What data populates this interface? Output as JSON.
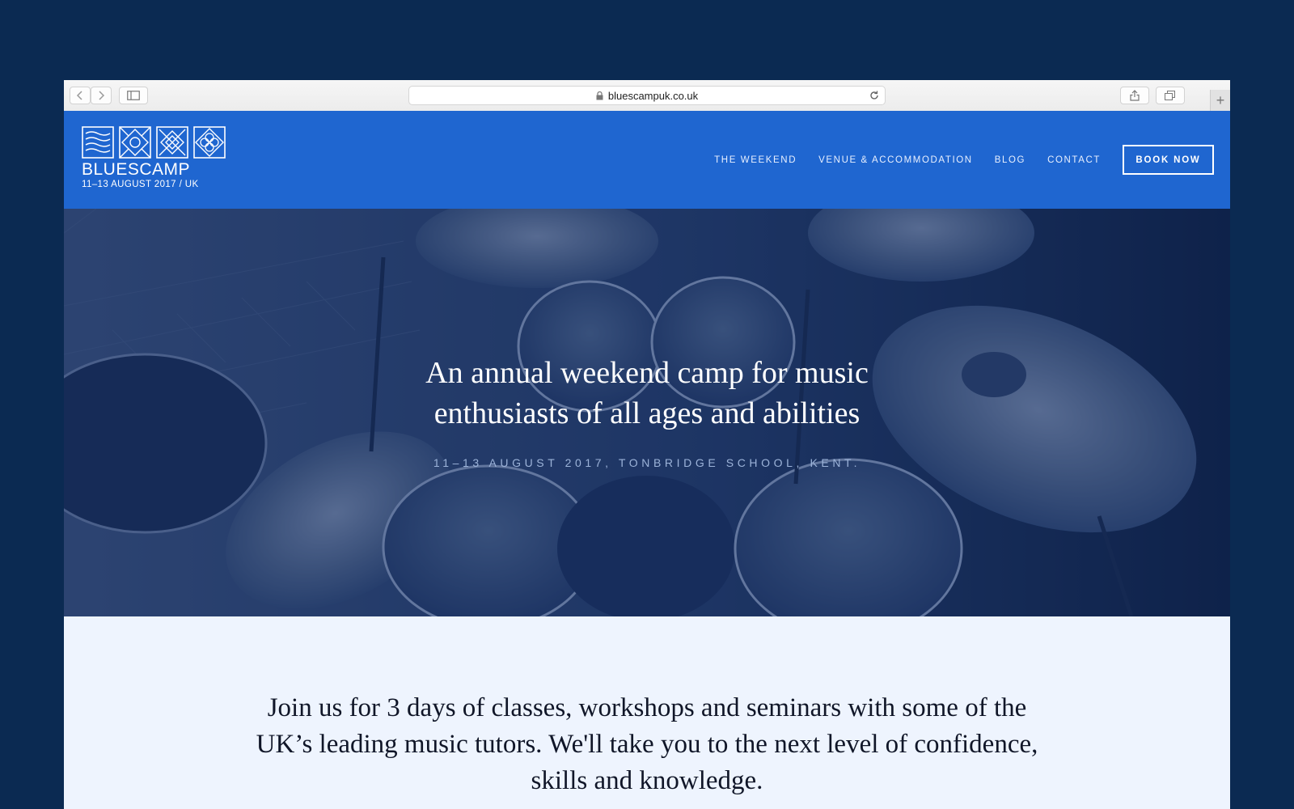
{
  "browser": {
    "url": "bluescampuk.co.uk",
    "icons": [
      "back-icon",
      "forward-icon",
      "sidebar-icon",
      "lock-icon",
      "reload-icon",
      "share-icon",
      "tabs-icon",
      "plus-icon"
    ],
    "new_tab_label": "+"
  },
  "site": {
    "logo": {
      "word": "BLUESCAMP",
      "date": "11–13 AUGUST 2017 / UK"
    },
    "nav": [
      {
        "label": "THE WEEKEND"
      },
      {
        "label": "VENUE & ACCOMMODATION"
      },
      {
        "label": "BLOG"
      },
      {
        "label": "CONTACT"
      }
    ],
    "cta": {
      "label": "BOOK NOW"
    },
    "colors": {
      "brand_blue": "#1f66d0",
      "page_bg": "#0b2a52",
      "hero_tint": "#1e3c73",
      "section_bg": "#eef4fe"
    }
  },
  "hero": {
    "title_line1": "An annual weekend camp for music",
    "title_line2": "enthusiasts of all ages and abilities",
    "subtitle": "11–13 AUGUST 2017, TONBRIDGE SCHOOL, KENT.",
    "image": "drum-kit-photo"
  },
  "intro": {
    "line1": "Join us for 3 days of classes, workshops and seminars with some of the",
    "line2": "UK’s leading music tutors. We'll take you to the next level of confidence,",
    "line3": "skills and knowledge."
  }
}
